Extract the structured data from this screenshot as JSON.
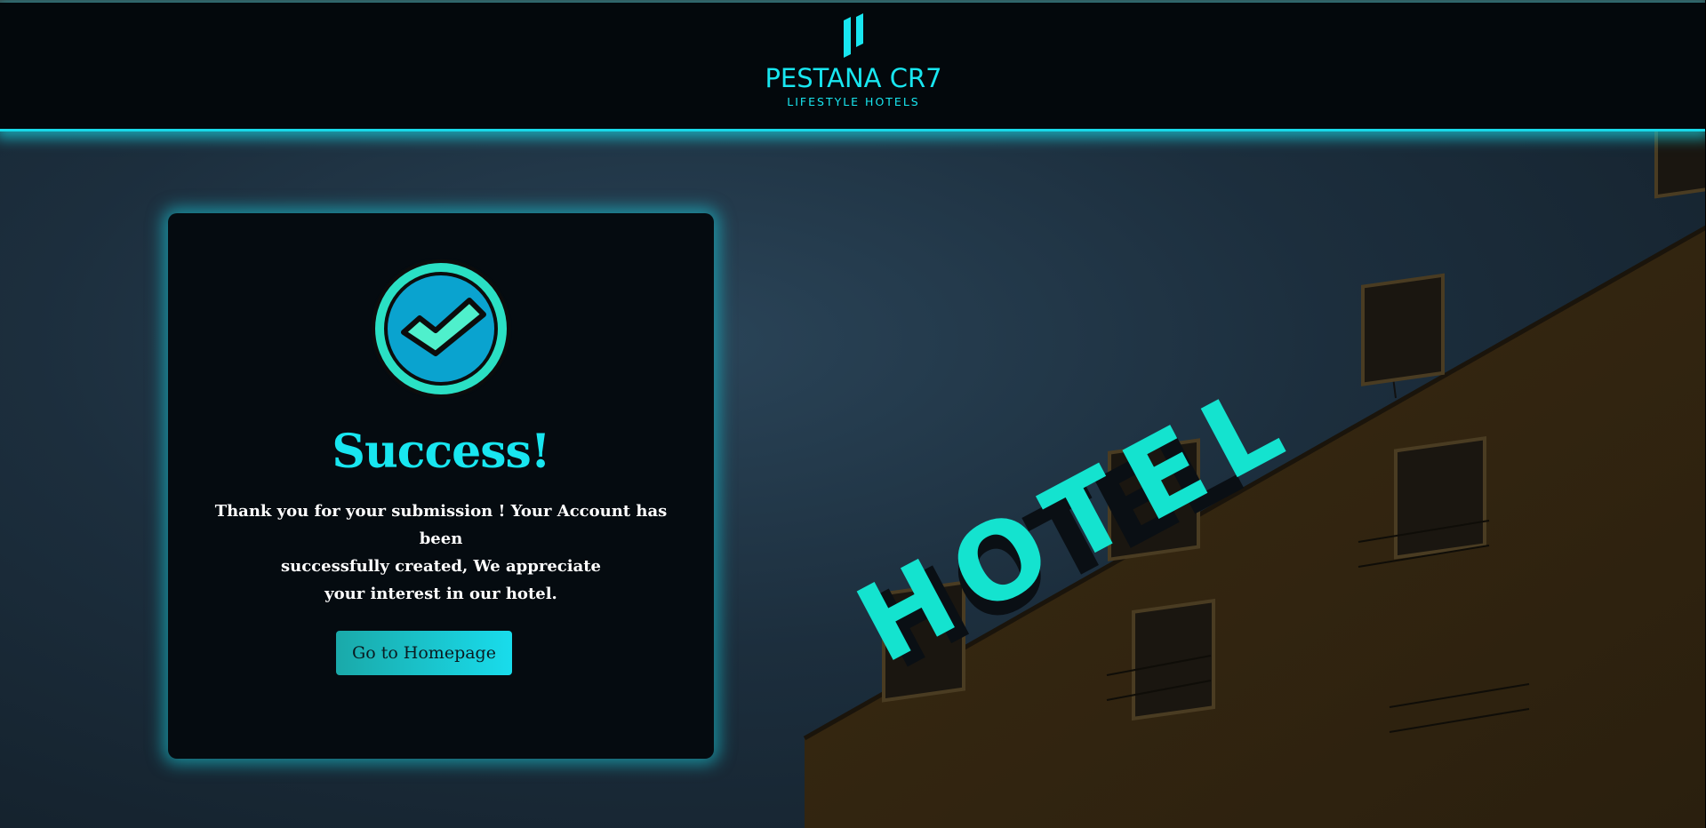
{
  "header": {
    "brand_name": "PESTANA CR7",
    "brand_tagline": "LIFESTYLE HOTELS"
  },
  "background": {
    "sign_text": "HOTEL"
  },
  "card": {
    "title": "Success!",
    "message_lines": [
      "Thank you for your submission !  Your Account has been",
      "successfully created,  We appreciate",
      "your interest in our hotel."
    ],
    "button_label": "Go to Homepage"
  },
  "colors": {
    "accent": "#18e6f0",
    "header_bg": "#03080c",
    "card_bg": "#050b10",
    "building": "#3a2a12"
  },
  "icons": {
    "logo": "brand-mark-icon",
    "success": "check-circle-icon"
  }
}
